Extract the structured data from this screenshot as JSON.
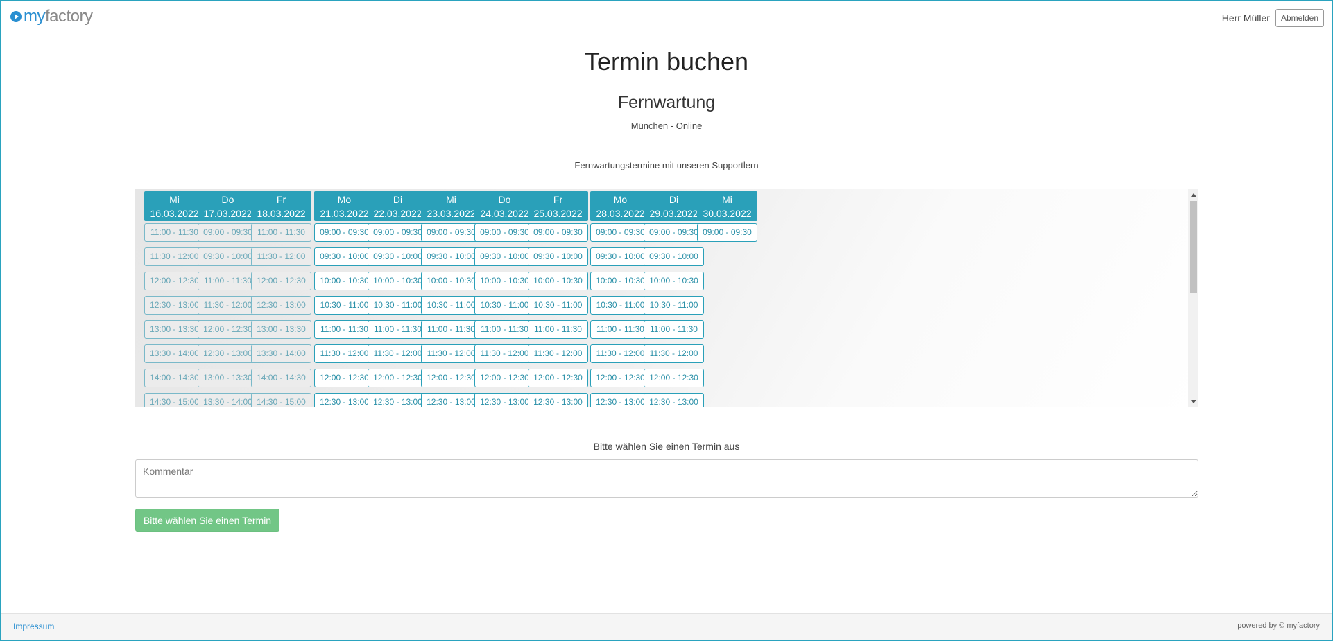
{
  "header": {
    "logo_my": "my",
    "logo_factory": "factory",
    "user_name": "Herr Müller",
    "logout_label": "Abmelden"
  },
  "page_title": "Termin buchen",
  "service": {
    "title": "Fernwartung",
    "location": "München - Online",
    "description": "Fernwartungstermine mit unseren Supportlern"
  },
  "calendar": {
    "days": [
      {
        "weekday": "Mi",
        "date": "16.03.2022",
        "slots": [
          {
            "time": "11:00 - 11:30",
            "past": true
          },
          {
            "time": "11:30 - 12:00",
            "past": true
          },
          {
            "time": "12:00 - 12:30",
            "past": true
          },
          {
            "time": "12:30 - 13:00",
            "past": true
          },
          {
            "time": "13:00 - 13:30",
            "past": true
          },
          {
            "time": "13:30 - 14:00",
            "past": true
          },
          {
            "time": "14:00 - 14:30",
            "past": true
          },
          {
            "time": "14:30 - 15:00",
            "past": true
          }
        ]
      },
      {
        "weekday": "Do",
        "date": "17.03.2022",
        "slots": [
          {
            "time": "09:00 - 09:30",
            "past": true
          },
          {
            "time": "09:30 - 10:00",
            "past": true
          },
          {
            "time": "11:00 - 11:30",
            "past": true
          },
          {
            "time": "11:30 - 12:00",
            "past": true
          },
          {
            "time": "12:00 - 12:30",
            "past": true
          },
          {
            "time": "12:30 - 13:00",
            "past": true
          },
          {
            "time": "13:00 - 13:30",
            "past": true
          },
          {
            "time": "13:30 - 14:00",
            "past": true
          }
        ]
      },
      {
        "weekday": "Fr",
        "date": "18.03.2022",
        "slots": [
          {
            "time": "11:00 - 11:30",
            "past": true
          },
          {
            "time": "11:30 - 12:00",
            "past": true
          },
          {
            "time": "12:00 - 12:30",
            "past": true
          },
          {
            "time": "12:30 - 13:00",
            "past": true
          },
          {
            "time": "13:00 - 13:30",
            "past": true
          },
          {
            "time": "13:30 - 14:00",
            "past": true
          },
          {
            "time": "14:00 - 14:30",
            "past": true
          },
          {
            "time": "14:30 - 15:00",
            "past": true
          }
        ]
      },
      {
        "weekday": "Mo",
        "date": "21.03.2022",
        "slots": [
          {
            "time": "09:00 - 09:30"
          },
          {
            "time": "09:30 - 10:00"
          },
          {
            "time": "10:00 - 10:30"
          },
          {
            "time": "10:30 - 11:00"
          },
          {
            "time": "11:00 - 11:30"
          },
          {
            "time": "11:30 - 12:00"
          },
          {
            "time": "12:00 - 12:30"
          },
          {
            "time": "12:30 - 13:00"
          }
        ]
      },
      {
        "weekday": "Di",
        "date": "22.03.2022",
        "slots": [
          {
            "time": "09:00 - 09:30"
          },
          {
            "time": "09:30 - 10:00"
          },
          {
            "time": "10:00 - 10:30"
          },
          {
            "time": "10:30 - 11:00"
          },
          {
            "time": "11:00 - 11:30"
          },
          {
            "time": "11:30 - 12:00"
          },
          {
            "time": "12:00 - 12:30"
          },
          {
            "time": "12:30 - 13:00"
          }
        ]
      },
      {
        "weekday": "Mi",
        "date": "23.03.2022",
        "slots": [
          {
            "time": "09:00 - 09:30"
          },
          {
            "time": "09:30 - 10:00"
          },
          {
            "time": "10:00 - 10:30"
          },
          {
            "time": "10:30 - 11:00"
          },
          {
            "time": "11:00 - 11:30"
          },
          {
            "time": "11:30 - 12:00"
          },
          {
            "time": "12:00 - 12:30"
          },
          {
            "time": "12:30 - 13:00"
          }
        ]
      },
      {
        "weekday": "Do",
        "date": "24.03.2022",
        "slots": [
          {
            "time": "09:00 - 09:30"
          },
          {
            "time": "09:30 - 10:00"
          },
          {
            "time": "10:00 - 10:30"
          },
          {
            "time": "10:30 - 11:00"
          },
          {
            "time": "11:00 - 11:30"
          },
          {
            "time": "11:30 - 12:00"
          },
          {
            "time": "12:00 - 12:30"
          },
          {
            "time": "12:30 - 13:00"
          }
        ]
      },
      {
        "weekday": "Fr",
        "date": "25.03.2022",
        "slots": [
          {
            "time": "09:00 - 09:30"
          },
          {
            "time": "09:30 - 10:00"
          },
          {
            "time": "10:00 - 10:30"
          },
          {
            "time": "10:30 - 11:00"
          },
          {
            "time": "11:00 - 11:30"
          },
          {
            "time": "11:30 - 12:00"
          },
          {
            "time": "12:00 - 12:30"
          },
          {
            "time": "12:30 - 13:00"
          }
        ]
      },
      {
        "weekday": "Mo",
        "date": "28.03.2022",
        "slots": [
          {
            "time": "09:00 - 09:30"
          },
          {
            "time": "09:30 - 10:00"
          },
          {
            "time": "10:00 - 10:30"
          },
          {
            "time": "10:30 - 11:00"
          },
          {
            "time": "11:00 - 11:30"
          },
          {
            "time": "11:30 - 12:00"
          },
          {
            "time": "12:00 - 12:30"
          },
          {
            "time": "12:30 - 13:00"
          }
        ]
      },
      {
        "weekday": "Di",
        "date": "29.03.2022",
        "slots": [
          {
            "time": "09:00 - 09:30"
          },
          {
            "time": "09:30 - 10:00"
          },
          {
            "time": "10:00 - 10:30"
          },
          {
            "time": "10:30 - 11:00"
          },
          {
            "time": "11:00 - 11:30"
          },
          {
            "time": "11:30 - 12:00"
          },
          {
            "time": "12:00 - 12:30"
          },
          {
            "time": "12:30 - 13:00"
          }
        ]
      },
      {
        "weekday": "Mi",
        "date": "30.03.2022",
        "slots": [
          {
            "time": "09:00 - 09:30"
          }
        ]
      }
    ]
  },
  "selection_hint": "Bitte wählen Sie einen Termin aus",
  "comment": {
    "placeholder": "Kommentar"
  },
  "submit_label": "Bitte wählen Sie einen Termin",
  "footer": {
    "impressum": "Impressum",
    "powered_by": "powered by © myfactory"
  },
  "colors": {
    "accent": "#2aa0b9",
    "brand_blue": "#2a8fd1",
    "submit_green": "#72c686"
  }
}
